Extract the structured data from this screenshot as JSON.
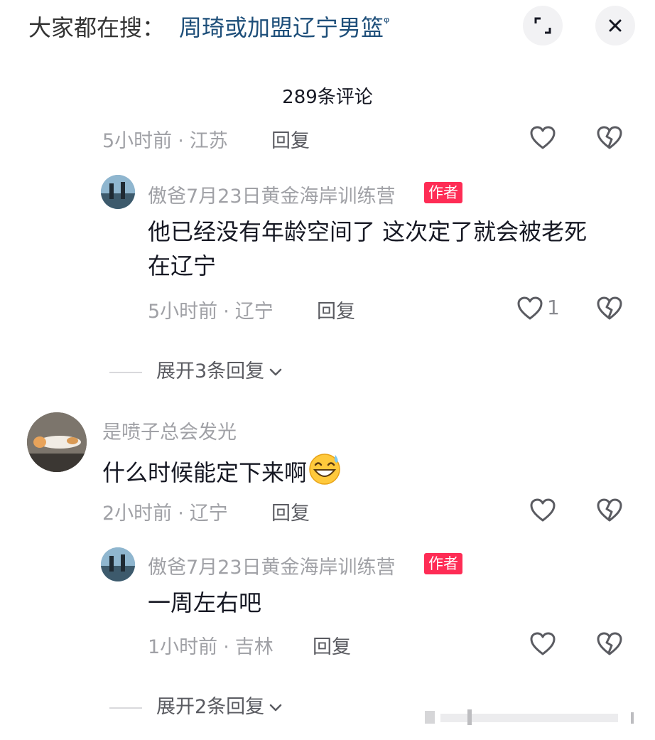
{
  "search": {
    "prefix": "大家都在搜：",
    "term": "周琦或加盟辽宁男篮",
    "magnifier": "ᵠ"
  },
  "header": {
    "comment_count": "289条评论"
  },
  "icons": {
    "expand": "expand-icon",
    "close": "close-icon",
    "like": "heart-outline-icon",
    "dislike": "broken-heart-icon",
    "chevron": "chevron-down-icon"
  },
  "colors": {
    "search_term": "#1e4f7a",
    "author_badge": "#fe2c55",
    "meta_text": "#a0a1a6"
  },
  "comments": [
    {
      "meta": {
        "time": "5小时前",
        "sep": "·",
        "location": "江苏",
        "reply": "回复"
      },
      "likes": ""
    },
    {
      "username": "傲爸7月23日黄金海岸训练营",
      "badge": "作者",
      "text_line1": "他已经没有年龄空间了 这次定了就会被老死",
      "text_line2": "在辽宁",
      "meta": {
        "time": "5小时前",
        "sep": "·",
        "location": "辽宁",
        "reply": "回复"
      },
      "likes": "1"
    },
    {
      "expand": "展开3条回复"
    },
    {
      "username": "是喷子总会发光",
      "text": "什么时候能定下来啊",
      "emoji": "grinning-sweat-emoji",
      "meta": {
        "time": "2小时前",
        "sep": "·",
        "location": "辽宁",
        "reply": "回复"
      },
      "likes": ""
    },
    {
      "username": "傲爸7月23日黄金海岸训练营",
      "badge": "作者",
      "text": "一周左右吧",
      "meta": {
        "time": "1小时前",
        "sep": "·",
        "location": "吉林",
        "reply": "回复"
      },
      "likes": ""
    },
    {
      "expand": "展开2条回复"
    }
  ]
}
